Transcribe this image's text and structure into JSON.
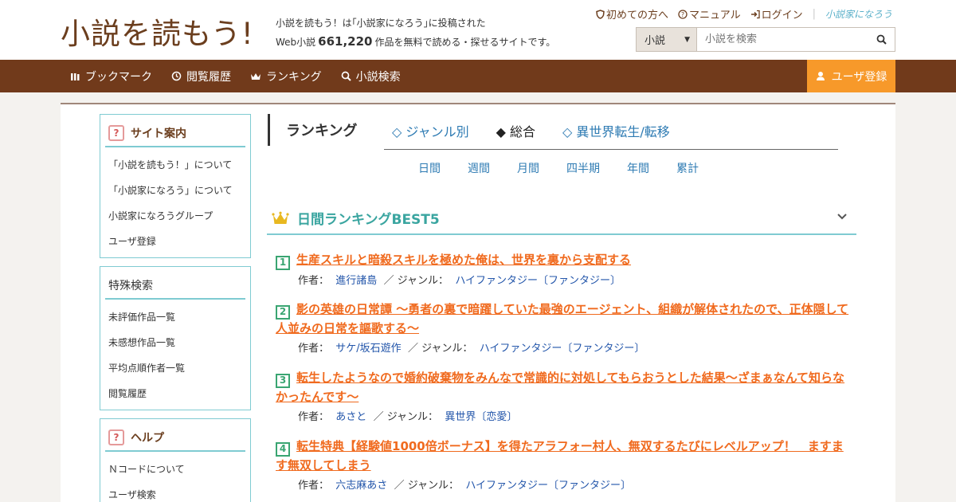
{
  "header": {
    "logo": "小説を読もう!",
    "tagline_line1": "小説を読もう！は｢小説家になろう｣に投稿された",
    "tagline_prefix": "Web小説",
    "work_count": "661,220",
    "tagline_suffix": "作品を無料で読める・探せるサイトです。",
    "links": [
      "初めての方へ",
      "マニュアル",
      "ログイン"
    ],
    "brand_small": "小説家になろう"
  },
  "search": {
    "select_value": "小説",
    "placeholder": "小説を検索"
  },
  "nav": {
    "items": [
      "ブックマーク",
      "閲覧履歴",
      "ランキング",
      "小説検索"
    ],
    "register": "ユーザ登録"
  },
  "sidebar": {
    "site_guide": {
      "title": "サイト案内",
      "items": [
        "「小説を読もう！」について",
        "「小説家になろう」について",
        "小説家になろうグループ",
        "ユーザ登録"
      ]
    },
    "special_search": {
      "title": "特殊検索",
      "items": [
        "未評価作品一覧",
        "未感想作品一覧",
        "平均点順作者一覧",
        "閲覧履歴"
      ]
    },
    "help": {
      "title": "ヘルプ",
      "items": [
        "Ｎコードについて",
        "ユーザ検索"
      ]
    }
  },
  "ranking": {
    "title": "ランキング",
    "tabs": [
      "◇ ジャンル別",
      "◆ 総合",
      "◇ 異世界転生/転移"
    ],
    "periods": [
      "日間",
      "週間",
      "月間",
      "四半期",
      "年間",
      "累計"
    ],
    "best_title": "日間ランキングBEST5",
    "author_label": "作者：",
    "genre_label": "／ ジャンル：",
    "entries": [
      {
        "rank": "1",
        "title": "生産スキルと暗殺スキルを極めた俺は、世界を裏から支配する",
        "author": "進行諸島",
        "genre": "ハイファンタジー〔ファンタジー〕"
      },
      {
        "rank": "2",
        "title": "影の英雄の日常譚 ～勇者の裏で暗躍していた最強のエージェント、組織が解体されたので、正体隠して人並みの日常を謳歌する～",
        "author": "サケ/坂石遊作",
        "genre": "ハイファンタジー〔ファンタジー〕"
      },
      {
        "rank": "3",
        "title": "転生したようなので婚約破棄物をみんなで常識的に対処してもらおうとした結果～ざまぁなんて知らなかったんです～",
        "author": "あさと",
        "genre": "異世界〔恋愛〕"
      },
      {
        "rank": "4",
        "title": "転生特典【経験値1000倍ボーナス】を得たアラフォー村人、無双するたびにレベルアップ！　ますます無双してしまう",
        "author": "六志麻あさ",
        "genre": "ハイファンタジー〔ファンタジー〕"
      }
    ]
  }
}
